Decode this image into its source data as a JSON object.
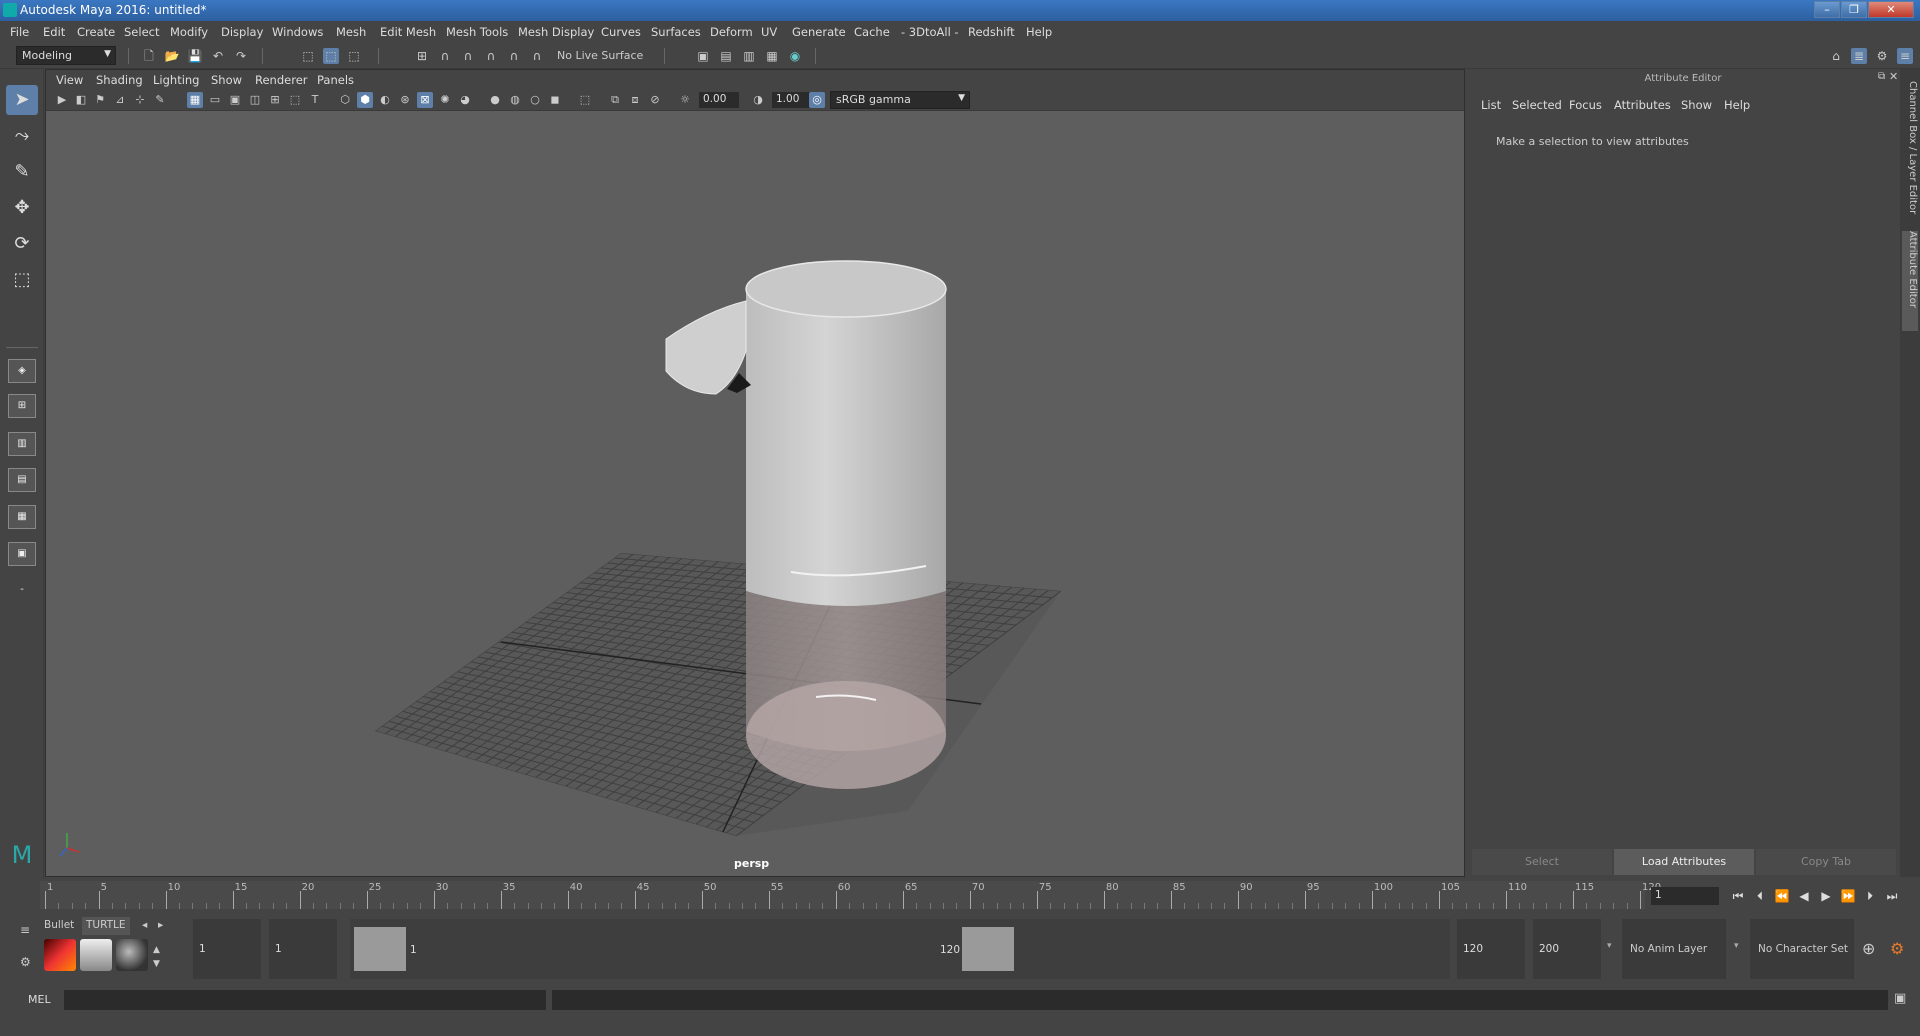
{
  "window": {
    "title": "Autodesk Maya 2016: untitled*",
    "minimize": "–",
    "maximize": "❐",
    "close": "✕"
  },
  "menus": [
    "File",
    "Edit",
    "Create",
    "Select",
    "Modify",
    "Display",
    "Windows",
    "Mesh",
    "Edit Mesh",
    "Mesh Tools",
    "Mesh Display",
    "Curves",
    "Surfaces",
    "Deform",
    "UV",
    "Generate",
    "Cache",
    "- 3DtoAll -",
    "Redshift",
    "Help"
  ],
  "status": {
    "mode": "Modeling",
    "live_surface": "No Live Surface"
  },
  "viewport": {
    "menus": [
      "View",
      "Shading",
      "Lighting",
      "Show",
      "Renderer",
      "Panels"
    ],
    "exposure": "0.00",
    "gamma": "1.00",
    "color_space": "sRGB gamma",
    "camera_label": "persp"
  },
  "attribute_editor": {
    "header": "Attribute Editor",
    "menus": [
      "List",
      "Selected",
      "Focus",
      "Attributes",
      "Show",
      "Help"
    ],
    "message": "Make a selection to view attributes",
    "buttons": {
      "select": "Select",
      "load": "Load Attributes",
      "copy": "Copy Tab"
    }
  },
  "side_tabs": {
    "channel_box": "Channel Box / Layer Editor",
    "attribute_editor": "Attribute Editor"
  },
  "timeline": {
    "ticks": [
      "1",
      "5",
      "10",
      "15",
      "20",
      "25",
      "30",
      "35",
      "40",
      "45",
      "50",
      "55",
      "60",
      "65",
      "70",
      "75",
      "80",
      "85",
      "90",
      "95",
      "100",
      "105",
      "110",
      "115",
      "120"
    ],
    "current_frame": "1"
  },
  "shelf": {
    "tabs": [
      "Bullet",
      "TURTLE"
    ]
  },
  "range": {
    "start": "1",
    "playback_start": "1",
    "range_start_label": "1",
    "range_end_label": "120",
    "playback_end": "120",
    "end": "200",
    "anim_layer": "No Anim Layer",
    "character_set": "No Character Set"
  },
  "command_line": {
    "label": "MEL"
  }
}
